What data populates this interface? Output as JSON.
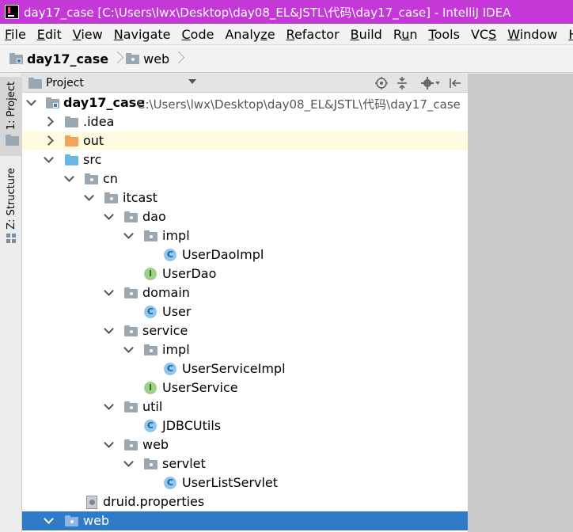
{
  "window": {
    "title": "day17_case [C:\\Users\\lwx\\Desktop\\day08_EL&JSTL\\代码\\day17_case] - IntelliJ IDEA"
  },
  "menu": {
    "items": [
      "File",
      "Edit",
      "View",
      "Navigate",
      "Code",
      "Analyze",
      "Refactor",
      "Build",
      "Run",
      "Tools",
      "VCS",
      "Window",
      "Help"
    ],
    "mnemonics": [
      "F",
      "E",
      "V",
      "N",
      "C",
      "z",
      "R",
      "B",
      "u",
      "T",
      "S",
      "W",
      "H"
    ]
  },
  "breadcrumb": {
    "items": [
      "day17_case",
      "web"
    ]
  },
  "sidebar": {
    "project_tab": "1: Project",
    "structure_tab": "Z: Structure"
  },
  "panel": {
    "title": "Project"
  },
  "tree": {
    "root_label": "day17_case",
    "root_path": "C:\\Users\\lwx\\Desktop\\day08_EL&JSTL\\代码\\day17_case",
    "nodes": [
      {
        "label": ".idea"
      },
      {
        "label": "out"
      },
      {
        "label": "src"
      },
      {
        "label": "cn"
      },
      {
        "label": "itcast"
      },
      {
        "label": "dao"
      },
      {
        "label": "impl"
      },
      {
        "label": "UserDaoImpl"
      },
      {
        "label": "UserDao"
      },
      {
        "label": "domain"
      },
      {
        "label": "User"
      },
      {
        "label": "service"
      },
      {
        "label": "impl"
      },
      {
        "label": "UserServiceImpl"
      },
      {
        "label": "UserService"
      },
      {
        "label": "util"
      },
      {
        "label": "JDBCUtils"
      },
      {
        "label": "web"
      },
      {
        "label": "servlet"
      },
      {
        "label": "UserListServlet"
      },
      {
        "label": "druid.properties"
      },
      {
        "label": "web"
      }
    ]
  },
  "colors": {
    "titlebar": "#c438d8",
    "selection": "#2f7bc7",
    "highlight_row": "#fffbe0",
    "class_icon": "#8dc7f1",
    "interface_icon": "#9fd08b"
  }
}
